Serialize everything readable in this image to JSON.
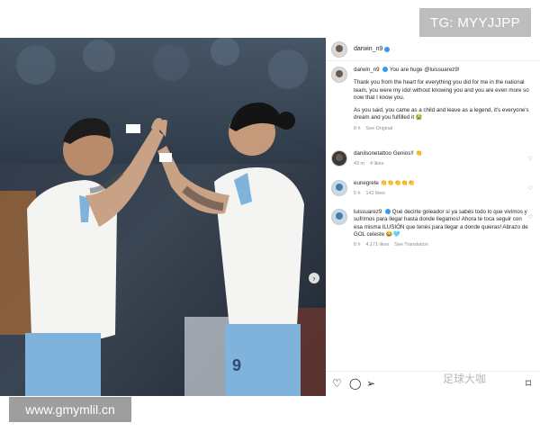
{
  "watermarks": {
    "top": "TG: MYYJJPP",
    "bottom": "www.gmymlil.cn",
    "logo": "足球大咖"
  },
  "post": {
    "username": "darwin_n9",
    "caption_user": "darwin_n9",
    "caption_mention": "You are huge @luissuarez9!",
    "caption_p1": "Thank you from the heart for everything you did for me in the national team, you were my idol without knowing you and you are even more so now that I know you.",
    "caption_p2": "As you said, you came as a child and leave as a legend, it's everyone's dream and you fulfilled it 😭",
    "caption_time": "8 h",
    "see_original": "See Original"
  },
  "comments": [
    {
      "user": "danilsonetattoo",
      "text": "Genios!! 👏",
      "time": "43 m",
      "likes": "4 likes"
    },
    {
      "user": "eunegrete",
      "text": "👏👏👏👏👏",
      "time": "5 h",
      "likes": "142 likes"
    },
    {
      "user": "luissuarez9",
      "text": "Qué decirte goleador si ya sabés todo lo que vivimos y sufrimos para llegar hasta donde llegamos! Ahora te toca seguir con esa misma ILUSIÓN que tenés para llegar a donde quieras! Abrazo de GOL celeste 😂🩵",
      "time": "8 h",
      "likes": "4,171 likes",
      "extra": "See Translation"
    }
  ],
  "colors": {
    "verified": "#3897f0",
    "jersey": "#f4f4f2",
    "shorts": "#7fb3dc"
  },
  "icons": [
    "heart-icon",
    "comment-icon",
    "share-icon",
    "bookmark-icon",
    "next-arrow-icon"
  ]
}
